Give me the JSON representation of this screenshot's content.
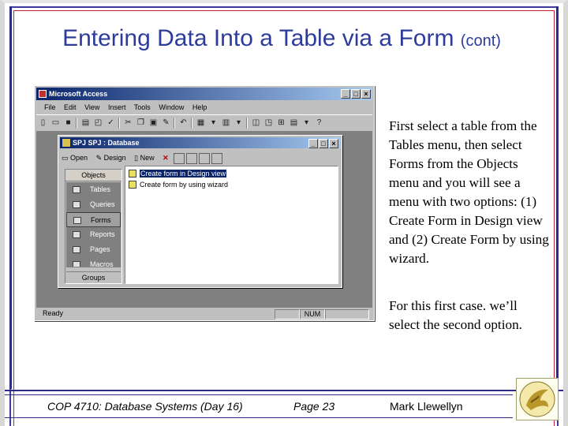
{
  "slide": {
    "title_main": "Entering Data Into a Table via a Form",
    "title_suffix": "(cont)",
    "paragraph1": "First select a table from the Tables menu, then select Forms from the Objects menu and you will see a menu with two options: (1) Create Form in Design view and (2) Create Form by using wizard.",
    "paragraph2": "For this first case. we’ll select the second option."
  },
  "access": {
    "title": "Microsoft Access",
    "menu": [
      "File",
      "Edit",
      "View",
      "Insert",
      "Tools",
      "Window",
      "Help"
    ],
    "status_left": "Ready",
    "status_num": "NUM",
    "db_window": {
      "title": "SPJ SPJ : Database",
      "toolbar": {
        "open": "Open",
        "design": "Design",
        "new": "New"
      },
      "objects_header": "Objects",
      "objects": [
        "Tables",
        "Queries",
        "Forms",
        "Reports",
        "Pages",
        "Macros"
      ],
      "selected_object": "Forms",
      "groups_label": "Groups",
      "list_items": [
        "Create form in Design view",
        "Create form by using wizard"
      ]
    }
  },
  "footer": {
    "course": "COP 4710: Database Systems  (Day 16)",
    "page": "Page 23",
    "author": "Mark Llewellyn"
  },
  "colors": {
    "title": "#2d3c9b",
    "frame_blue": "#2f2b8a",
    "frame_red": "#c41e3a",
    "titlebar": "#0a246a"
  }
}
